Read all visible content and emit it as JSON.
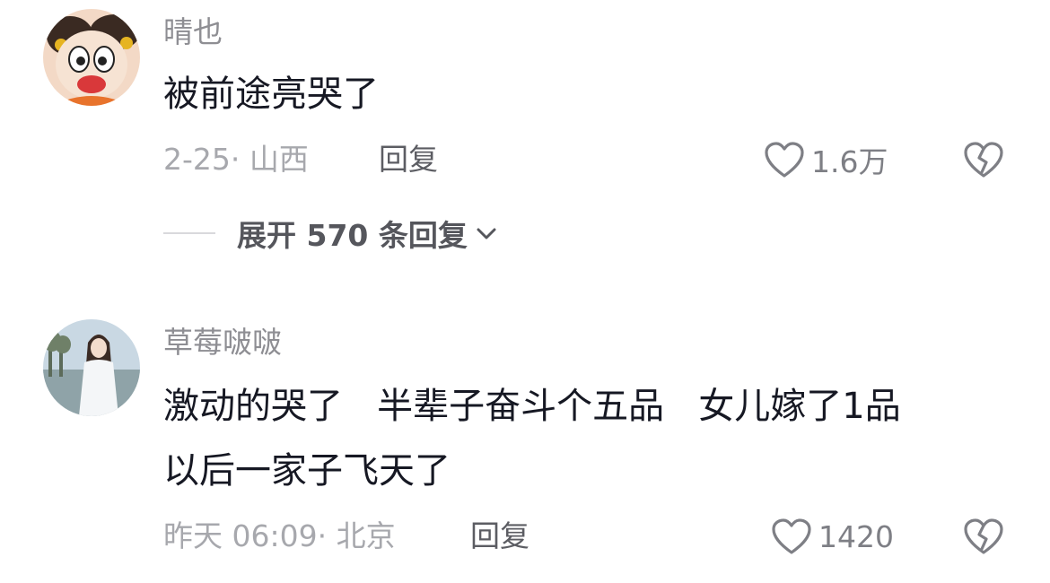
{
  "comments": [
    {
      "username": "晴也",
      "lines": [
        "被前途亮哭了"
      ],
      "meta": "2-25· 山西",
      "reply_label": "回复",
      "likes": "1.6万",
      "like_icon": "heart-outline-icon",
      "dislike_icon": "broken-heart-icon",
      "expand_label": "展开 570 条回复"
    },
    {
      "username": "草莓啵啵",
      "lines": [
        "激动的哭了   半辈子奋斗个五品   女儿嫁了1品",
        "以后一家子飞天了"
      ],
      "meta": "昨天 06:09· 北京",
      "reply_label": "回复",
      "likes": "1420",
      "like_icon": "heart-outline-icon",
      "dislike_icon": "broken-heart-icon"
    }
  ]
}
